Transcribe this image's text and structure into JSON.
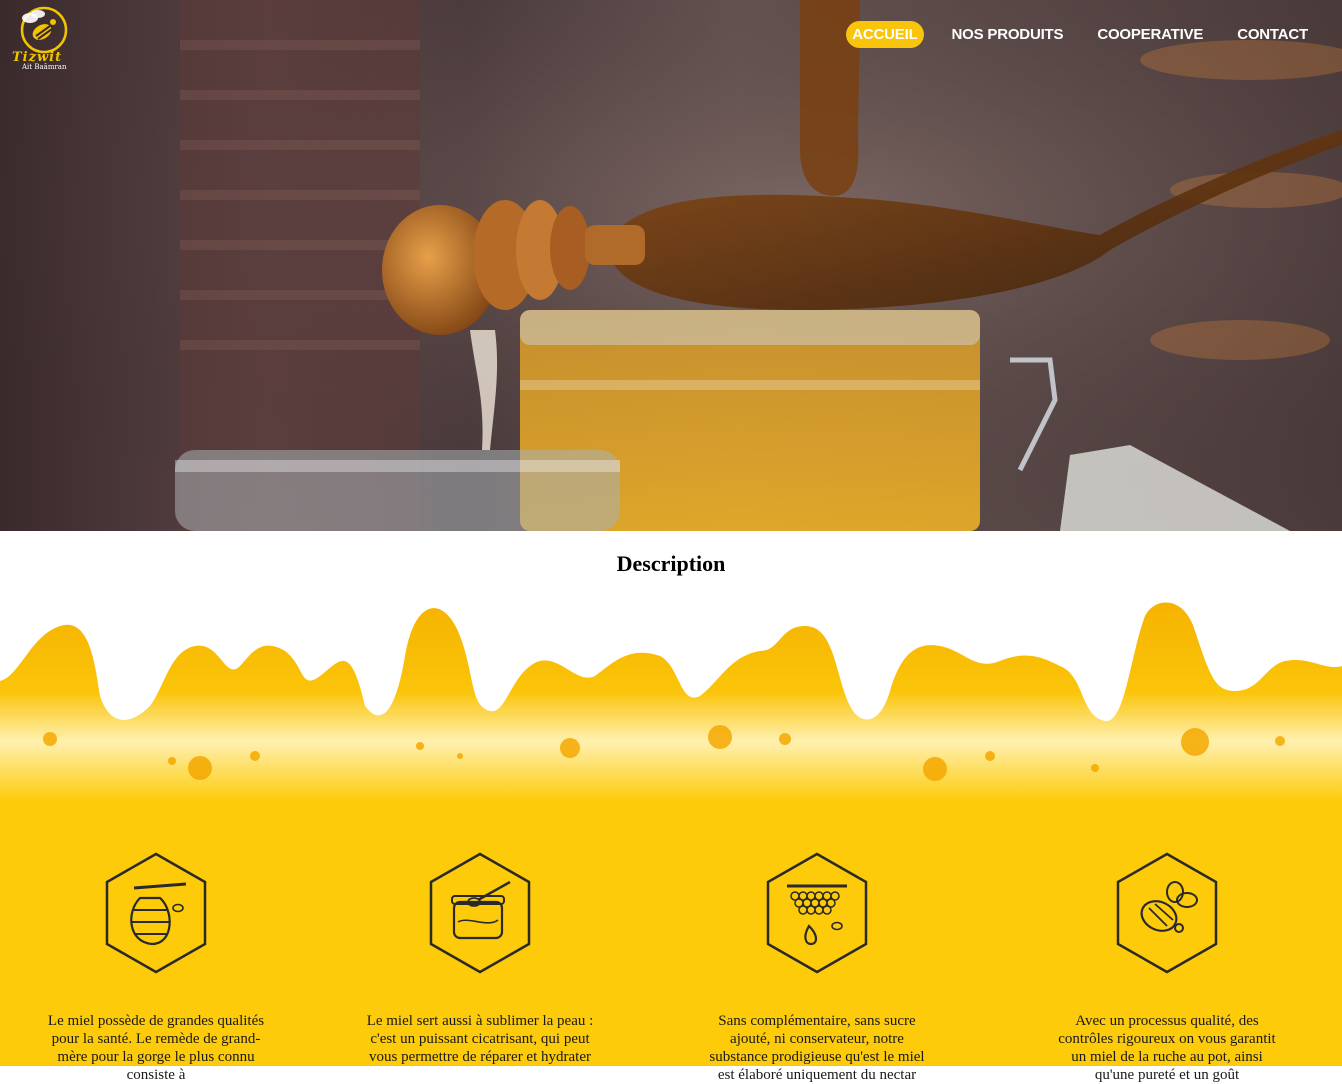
{
  "brand": {
    "name": "Tizwit",
    "subtitle": "Ait Baâmran"
  },
  "nav": {
    "items": [
      {
        "label": "ACCUEIL",
        "active": true
      },
      {
        "label": "NOS PRODUITS",
        "active": false
      },
      {
        "label": "COOPERATIVE",
        "active": false
      },
      {
        "label": "CONTACT",
        "active": false
      }
    ]
  },
  "description": {
    "title": "Description"
  },
  "features": [
    {
      "icon": "beehive-icon",
      "text": "Le miel possède de grandes qualités pour la santé. Le remède de grand-mère pour la gorge le plus connu consiste à"
    },
    {
      "icon": "honey-jar-icon",
      "text": "Le miel sert aussi à sublimer la peau : c'est un puissant cicatrisant, qui peut vous permettre de réparer et hydrater"
    },
    {
      "icon": "honeycomb-drop-icon",
      "text": "Sans complémentaire, sans sucre ajouté, ni conservateur, notre substance prodigieuse qu'est le miel est élaboré uniquement du nectar"
    },
    {
      "icon": "bee-icon",
      "text": "Avec un processus qualité, des contrôles rigoureux on vous garantit un miel de la ruche au pot, ainsi qu'une pureté et un goût"
    }
  ],
  "colors": {
    "accent": "#f8c40c",
    "honey": "#fdcb0a"
  }
}
